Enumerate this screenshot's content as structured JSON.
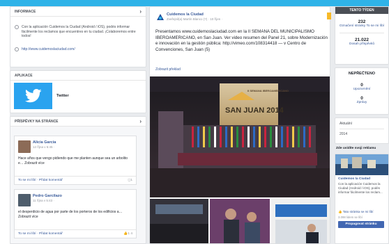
{
  "sidebar": {
    "info": {
      "title": "INFORMACE",
      "description": "Con la aplicación Cuidemos la Ciudad (Android / iOS), podés informar fácilmente los reclamos que encuentres en tu ciudad. ¡Colaboremos entre todos!",
      "website": "http://www.cuidemoslaciudad.com/"
    },
    "apps": {
      "title": "APLIKACE",
      "twitter_label": "Twitter"
    },
    "posts": {
      "title": "PŘÍSPĚVKY NA STRÁNCE",
      "items": [
        {
          "author": "Alicia García",
          "meta": "12 října v 6:45 ·",
          "text": "Hace años que vengo pidiendo que me planten aunque sea un arbolito e… Zobrazit více",
          "like": "To se mi líbí · Přidat komentář",
          "count": "1"
        },
        {
          "author": "Pedro Garcilazo",
          "meta": "11 října v 5:43 ·",
          "text": "el desperdicio de agua por parte de los porteros de los edificios a… Zobrazit více",
          "like": "To se mi líbí · Přidat komentář",
          "count": "1  4"
        }
      ]
    }
  },
  "center": {
    "page_name": "Cuidemos la Ciudad",
    "meta": "Zveřejnil(a) Martín Blanco (?) · 10 říjen ·",
    "text": "Presentamos www.cuidemoslaciudad.com en la II SEMANA DEL MUNICIPALISMO IBEROAMERICANO, en San Juan. Ver video resumen del Panel 21, sobre Modernización e innovación en la gestión pública: http://vimeo.com/108314418 — v Centro de Convenciones, San Juan (5)",
    "see_more": "Zobrazit překlad",
    "banner_title": "SAN JUAN 2014",
    "banner_subtitle": "II SEMANA IBEROAMERICANO"
  },
  "right": {
    "header": "TENTO TÝDEN",
    "stats": [
      {
        "value": "232",
        "label": "Označení stránky To se mi líbí"
      },
      {
        "value": "21.022",
        "label": "Dosah příspěvků"
      }
    ],
    "unread_title": "NEPŘEČTENO",
    "unread": [
      {
        "value": "0",
        "label": "Upozornění"
      },
      {
        "value": "0",
        "label": "Zprávy"
      }
    ],
    "recent": [
      "Aktuální",
      "2014"
    ],
    "ad_title": "Zde uvidíte svoji reklamu",
    "ad_page": "Cuidemos la Ciudad",
    "ad_text": "Con la aplicación Cuidemos la Ciudad (Android / iOS), podés informar fácilmente los reclam...",
    "ad_like": "Tato stránka se mi líbí",
    "ad_count": "3.098 lidem se líbí",
    "promote": "Propagovat stránku"
  },
  "colors": {
    "accent": "#2fb3e8",
    "link": "#365899",
    "promote": "#4267b2"
  }
}
